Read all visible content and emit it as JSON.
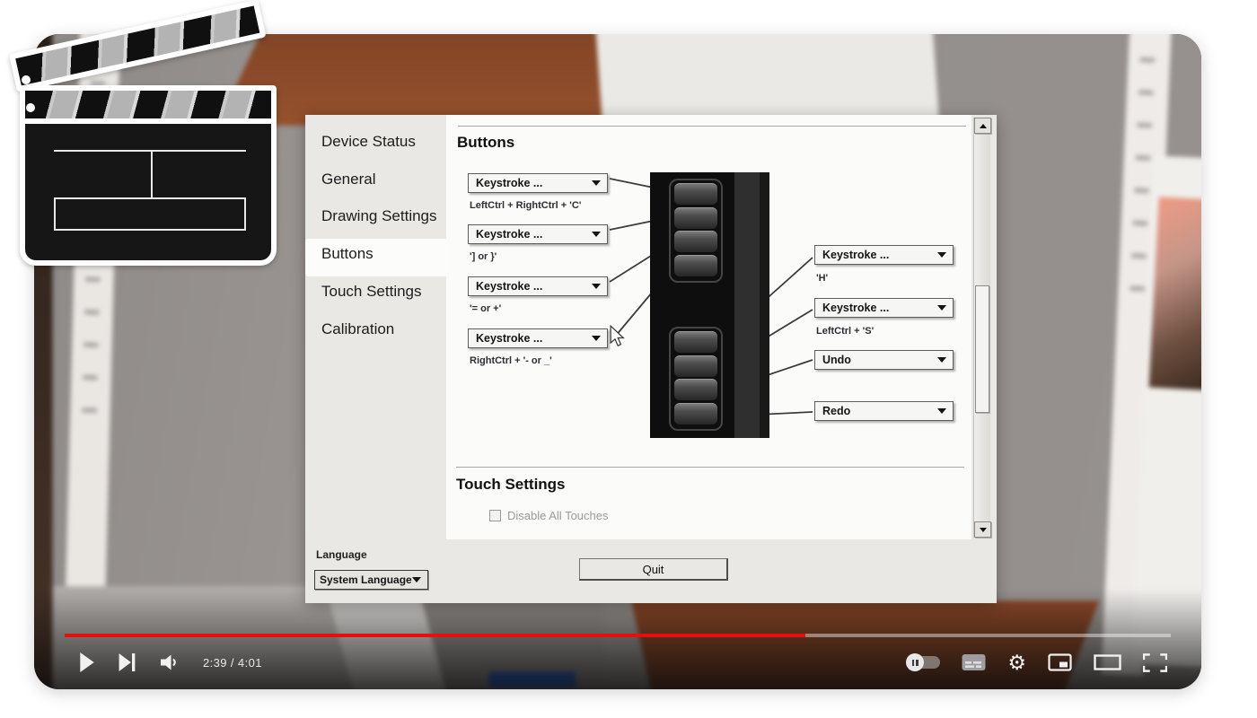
{
  "player": {
    "time": "2:39 / 4:01",
    "progress_percent": 67,
    "progress_color": "#e60f0f"
  },
  "icons": {
    "settings_gear": "⚙"
  },
  "dialog": {
    "sidebar": {
      "items": [
        {
          "label": "Device Status"
        },
        {
          "label": "General"
        },
        {
          "label": "Drawing Settings"
        },
        {
          "label": "Buttons"
        },
        {
          "label": "Touch Settings"
        },
        {
          "label": "Calibration"
        }
      ],
      "selected": "Buttons"
    },
    "buttons_section": {
      "title": "Buttons",
      "left": [
        {
          "value": "Keystroke ...",
          "hotkey": "LeftCtrl + RightCtrl + 'C'"
        },
        {
          "value": "Keystroke ...",
          "hotkey": "'] or }'"
        },
        {
          "value": "Keystroke ...",
          "hotkey": "'= or +'"
        },
        {
          "value": "Keystroke ...",
          "hotkey": "RightCtrl + '- or _'"
        }
      ],
      "right": [
        {
          "value": "Keystroke ...",
          "hotkey": "'H'"
        },
        {
          "value": "Keystroke ...",
          "hotkey": "LeftCtrl + 'S'"
        },
        {
          "value": "Undo",
          "hotkey": ""
        },
        {
          "value": "Redo",
          "hotkey": ""
        }
      ]
    },
    "touch_section": {
      "title": "Touch Settings",
      "checkbox_label": "Disable All Touches",
      "checkbox_checked": false
    },
    "footer": {
      "language_label": "Language",
      "language_value": "System Language",
      "quit_label": "Quit"
    }
  }
}
